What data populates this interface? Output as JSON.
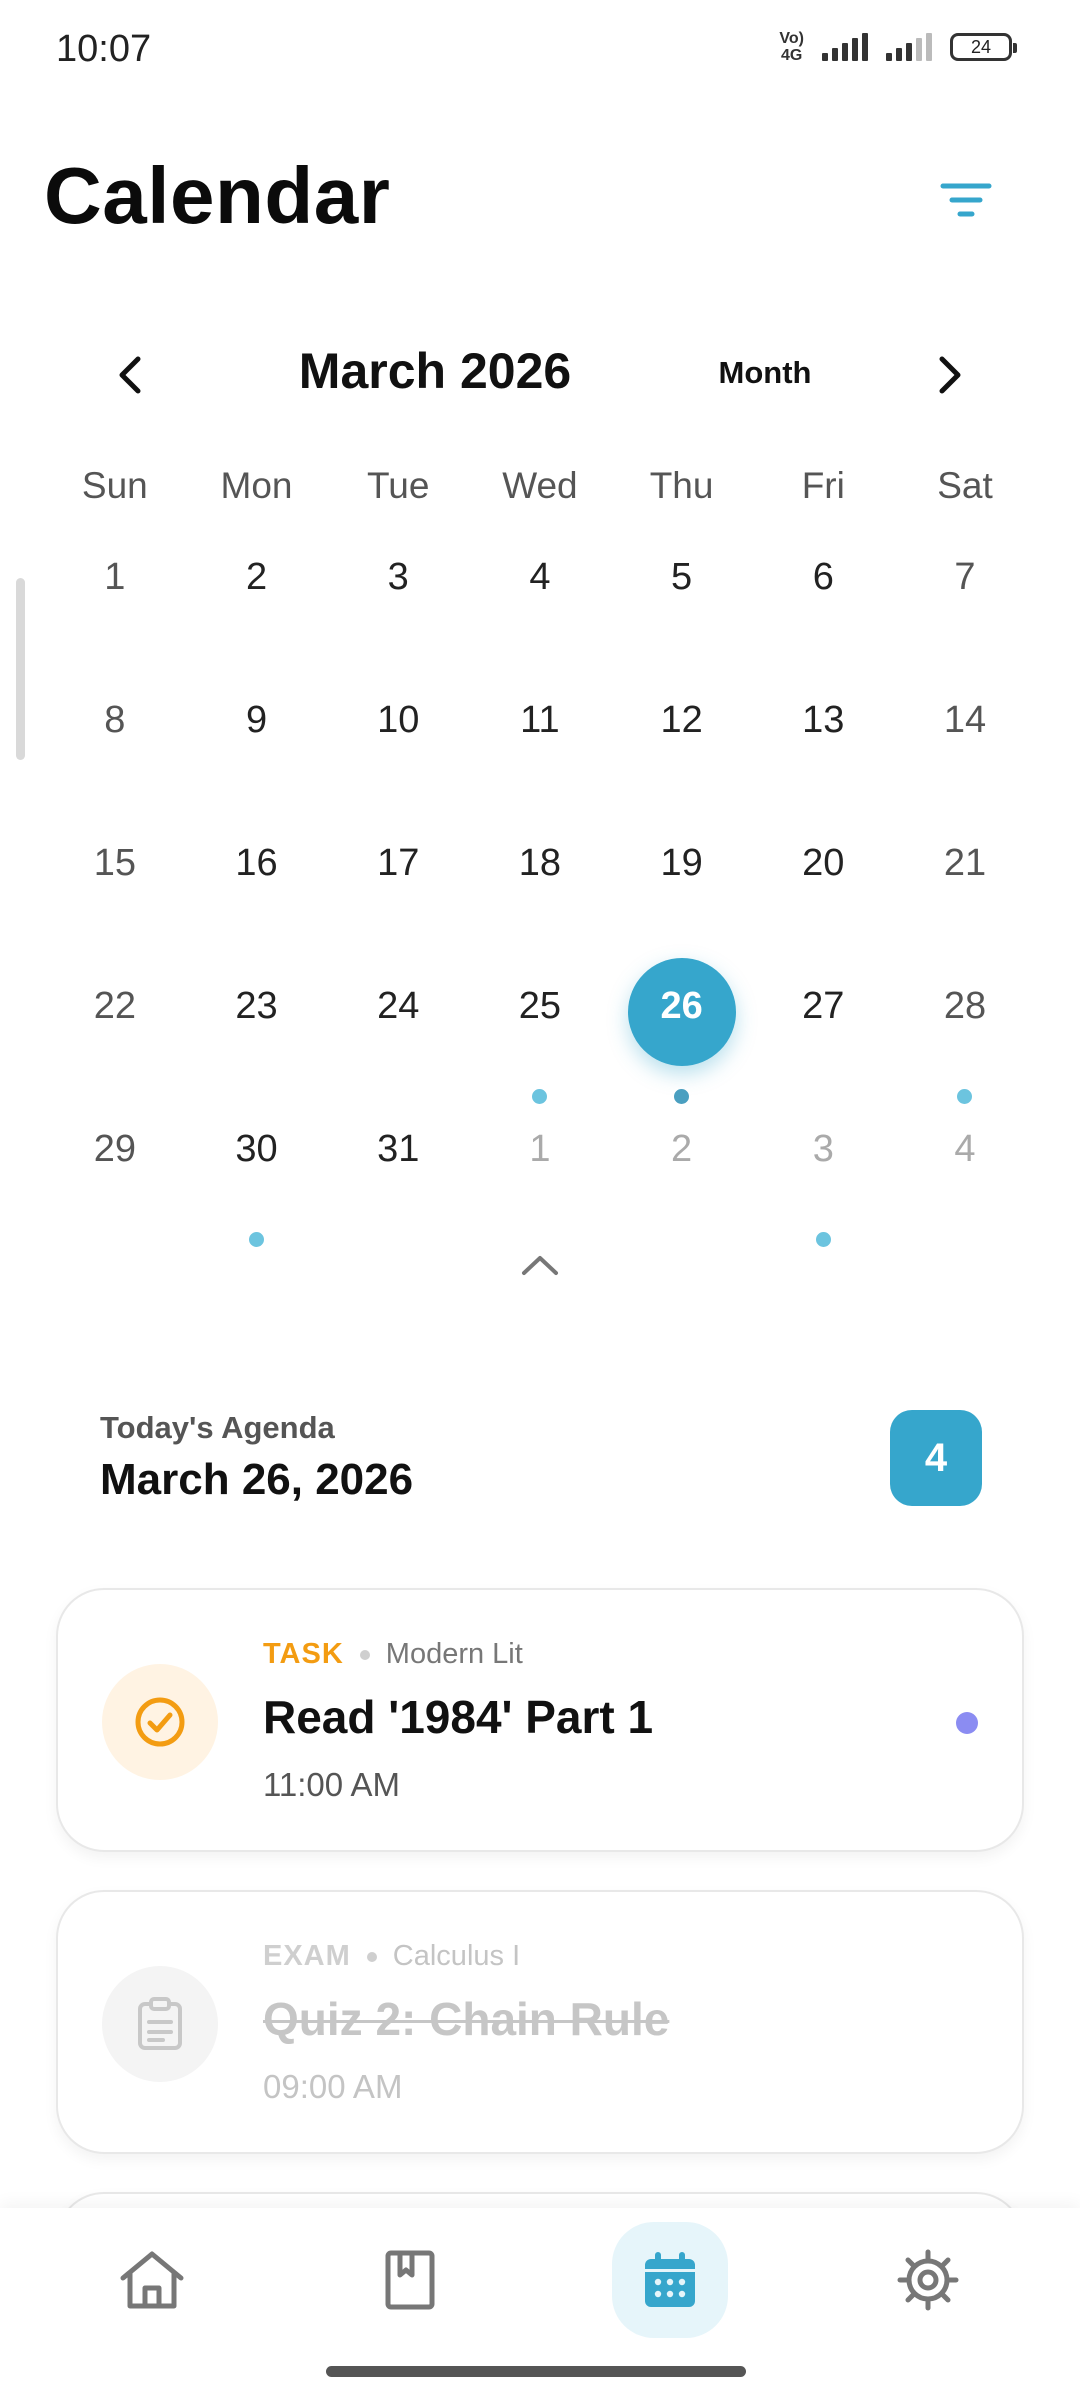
{
  "status_bar": {
    "time": "10:07",
    "network_label_top": "Vo)",
    "network_label_bottom": "4G",
    "battery": "24"
  },
  "header": {
    "title": "Calendar",
    "filter_icon": "filter-icon"
  },
  "calendar": {
    "month_label": "March 2026",
    "view_mode": "Month",
    "weekdays": [
      "Sun",
      "Mon",
      "Tue",
      "Wed",
      "Thu",
      "Fri",
      "Sat"
    ],
    "weeks": [
      [
        "1",
        "2",
        "3",
        "4",
        "5",
        "6",
        "7"
      ],
      [
        "8",
        "9",
        "10",
        "11",
        "12",
        "13",
        "14"
      ],
      [
        "15",
        "16",
        "17",
        "18",
        "19",
        "20",
        "21"
      ],
      [
        "22",
        "23",
        "24",
        "25",
        "26",
        "27",
        "28"
      ],
      [
        "29",
        "30",
        "31",
        "1",
        "2",
        "3",
        "4"
      ]
    ],
    "selected_day": "26",
    "days_with_events": [
      "25",
      "26",
      "28",
      "30",
      "3"
    ]
  },
  "agenda": {
    "label": "Today's Agenda",
    "date": "March 26, 2026",
    "count": "4",
    "items": [
      {
        "type": "TASK",
        "course": "Modern Lit",
        "title": "Read '1984' Part 1",
        "time": "11:00 AM",
        "icon": "check-circle-icon",
        "accent": "#f39c12",
        "completed": false
      },
      {
        "type": "EXAM",
        "course": "Calculus I",
        "title": "Quiz 2: Chain Rule",
        "time": "09:00 AM",
        "icon": "clipboard-icon",
        "accent": "#cfcfcf",
        "completed": true
      }
    ]
  },
  "colors": {
    "primary": "#36a6cc",
    "task_accent": "#f39c12",
    "priority": "#8b8cf2"
  },
  "bottom_nav": {
    "items": [
      "home-icon",
      "library-icon",
      "calendar-icon",
      "settings-icon"
    ],
    "active": "calendar-icon"
  }
}
